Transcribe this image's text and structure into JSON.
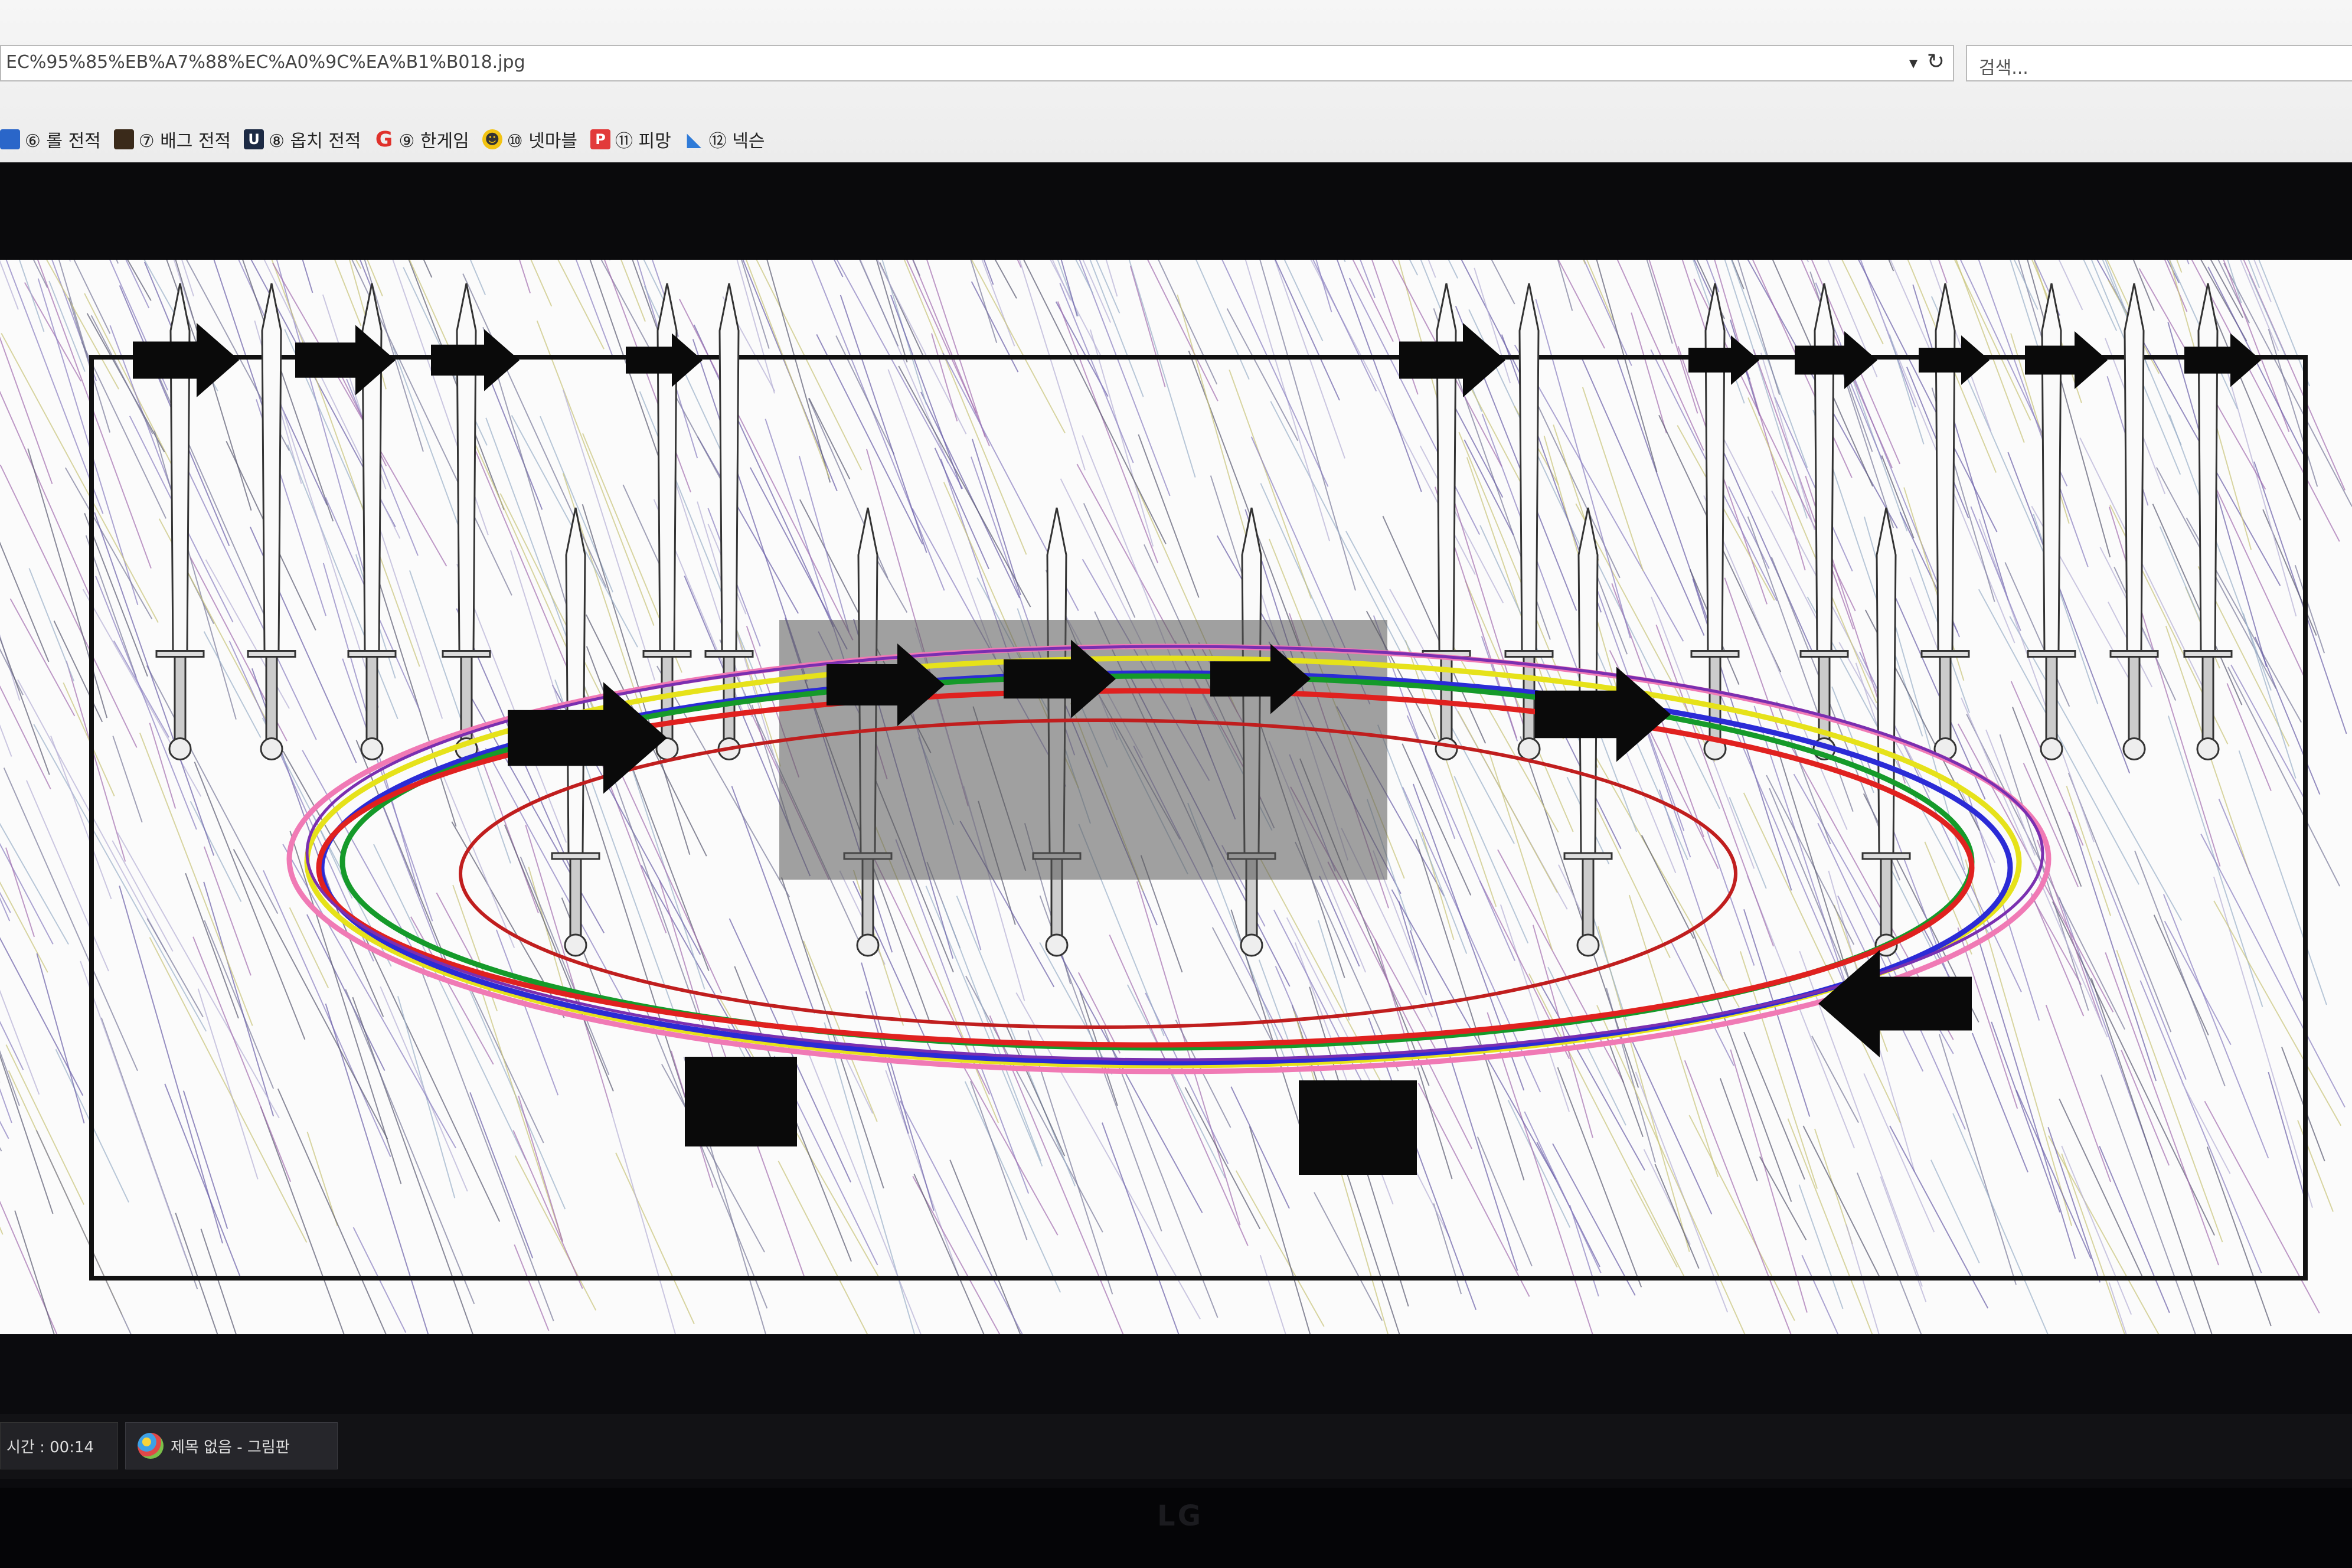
{
  "browser": {
    "address": "EC%95%85%EB%A7%88%EC%A0%9C%EA%B1%B018.jpg",
    "search_placeholder": "검색...",
    "bookmarks": [
      {
        "label": "⑥ 롤 전적",
        "icon": "lol-icon",
        "color": "#2a66c9",
        "glyph": ""
      },
      {
        "label": "⑦ 배그 전적",
        "icon": "pubg-icon",
        "color": "#3a2a1a",
        "glyph": ""
      },
      {
        "label": "⑧ 옵치 전적",
        "icon": "overwatch-icon",
        "color": "#1c2a44",
        "glyph": "U"
      },
      {
        "label": "⑨ 한게임",
        "icon": "hangame-icon",
        "color": "#e0312b",
        "glyph": "G"
      },
      {
        "label": "⑩ 넷마블",
        "icon": "netmarble-icon",
        "color": "#f2c312",
        "glyph": "☻"
      },
      {
        "label": "⑪ 피망",
        "icon": "pmang-icon",
        "color": "#e23a3a",
        "glyph": "P"
      },
      {
        "label": "⑫ 넥슨",
        "icon": "nexon-icon",
        "color": "#2f7bd8",
        "glyph": "◣"
      }
    ]
  },
  "taskbar": {
    "clock": "시간 : 00:14",
    "paint_window": "제목 없음 - 그림판"
  },
  "monitor": {
    "brand": "LG"
  }
}
